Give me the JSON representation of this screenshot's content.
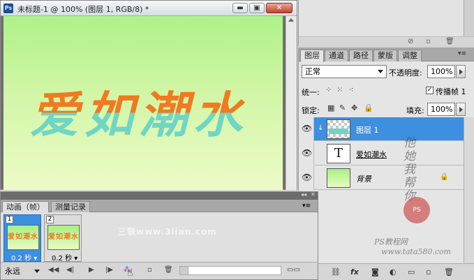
{
  "document": {
    "title": "未标题-1 @ 100% (图层 1, RGB/8) *",
    "app_badge": "Ps",
    "btn_min": "▬",
    "btn_max": "▣",
    "btn_close": "✕",
    "artwork_text": "爱如潮水"
  },
  "layers_panel": {
    "tabs": [
      "图层",
      "通道",
      "路径",
      "蒙版",
      "调整"
    ],
    "blend_mode": "正常",
    "opacity_label": "不透明度:",
    "opacity_value": "100%",
    "unify_label": "统一:",
    "propagate_label": "传播帧 1",
    "lock_label": "锁定:",
    "fill_label": "填充:",
    "fill_value": "100%",
    "layers": [
      {
        "name": "图层 1",
        "selected": true,
        "type": "pixel"
      },
      {
        "name": "爱如潮水",
        "selected": false,
        "type": "text"
      },
      {
        "name": "背景",
        "selected": false,
        "type": "background",
        "locked": true
      }
    ]
  },
  "watermarks": {
    "handwriting": "他她我帮你",
    "stamp": "PS",
    "site_text": "PS教程网",
    "site_url": "www.tata580.com",
    "lian": "三联www.3lian.com"
  },
  "animation_panel": {
    "tabs": [
      "动画（帧）",
      "测量记录"
    ],
    "frames": [
      {
        "number": "1",
        "delay": "0.2 秒",
        "selected": true
      },
      {
        "number": "2",
        "delay": "0.2 秒",
        "selected": false
      }
    ],
    "loop": "永远"
  },
  "colors": {
    "selection": "#3d8fe0",
    "art_orange": "#f07a20",
    "art_teal": "#6fd6c5",
    "canvas_green": "#aef189"
  }
}
